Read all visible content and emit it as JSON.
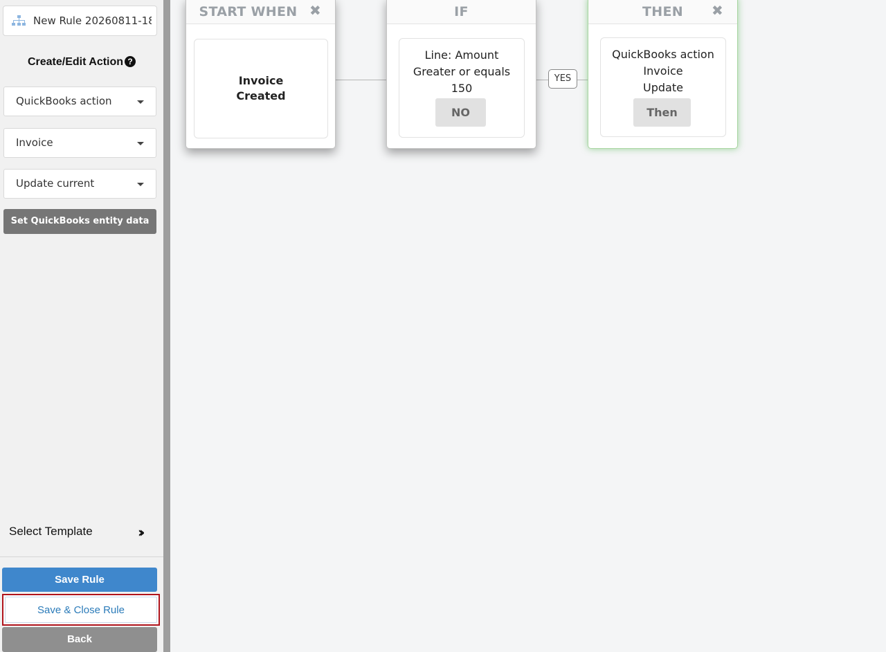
{
  "sidebar": {
    "rule_name_value": "New Rule 20260811-18",
    "section_title": "Create/Edit Action",
    "selects": {
      "action_type": "QuickBooks action",
      "entity": "Invoice",
      "operation": "Update current"
    },
    "set_data_label": "Set QuickBooks entity data",
    "template_label": "Select Template",
    "save_label": "Save Rule",
    "save_close_label": "Save & Close Rule",
    "back_label": "Back"
  },
  "canvas": {
    "start": {
      "title": "START WHEN",
      "line1": "Invoice",
      "line2": "Created"
    },
    "if": {
      "title": "IF",
      "line1": "Line: Amount",
      "line2": "Greater or equals",
      "line3": "150",
      "no_label": "NO"
    },
    "yes_label": "YES",
    "then": {
      "title": "THEN",
      "line1": "QuickBooks action",
      "line2": "Invoice",
      "line3": "Update",
      "then_label": "Then"
    }
  },
  "colors": {
    "primary": "#3f87cc",
    "highlight_border": "#b0141c",
    "then_glow": "#a9d6a2"
  }
}
